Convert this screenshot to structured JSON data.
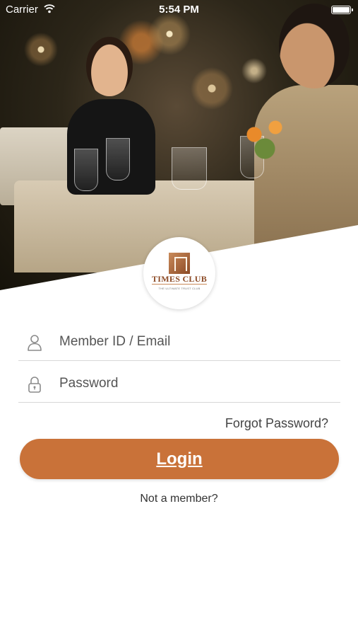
{
  "status_bar": {
    "carrier": "Carrier",
    "time": "5:54 PM"
  },
  "logo": {
    "name": "TIMES CLUB",
    "tagline": "THE ULTIMATE TRUST CLUB"
  },
  "form": {
    "member_placeholder": "Member ID / Email",
    "password_placeholder": "Password",
    "forgot_label": "Forgot Password?",
    "login_label": "Login",
    "not_member_label": "Not a member?"
  },
  "colors": {
    "accent": "#c97239",
    "logo_brand": "#8c4a25"
  },
  "icons": {
    "member": "user-icon",
    "password": "lock-icon",
    "wifi": "wifi-icon",
    "battery": "battery-icon"
  }
}
